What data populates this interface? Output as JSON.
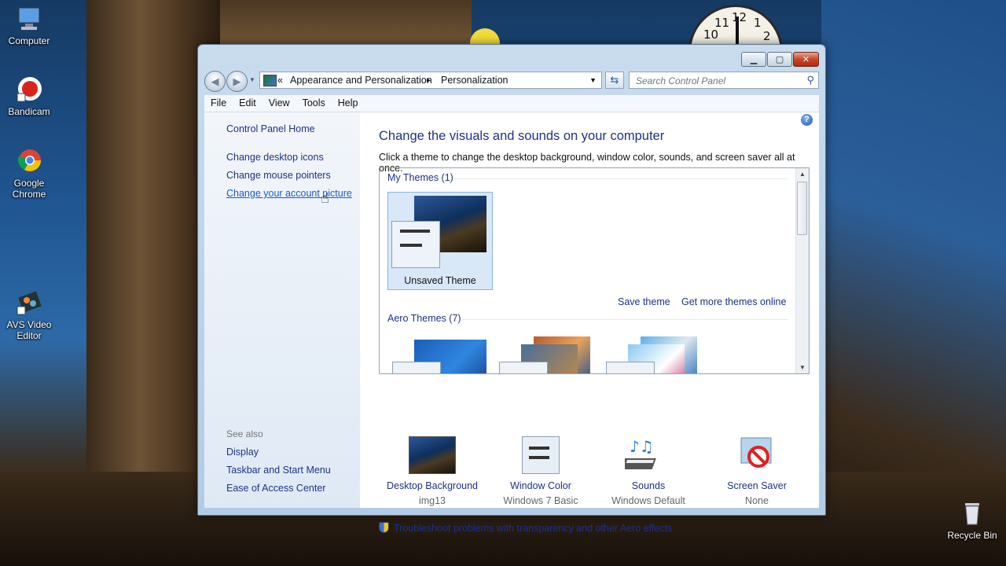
{
  "desktop": {
    "icons": [
      {
        "label": "Computer",
        "icon": "computer-icon"
      },
      {
        "label": "Bandicam",
        "icon": "bandicam-icon"
      },
      {
        "label": "Google Chrome",
        "icon": "chrome-icon"
      },
      {
        "label": "AVS Video Editor",
        "icon": "avs-video-editor-icon"
      },
      {
        "label": "Recycle Bin",
        "icon": "recycle-bin-icon"
      }
    ],
    "clock_numbers": [
      "10",
      "11",
      "12",
      "1",
      "2"
    ]
  },
  "window": {
    "breadcrumb": {
      "prefix": "«",
      "items": [
        "Appearance and Personalization",
        "Personalization"
      ],
      "separator": "▸"
    },
    "search_placeholder": "Search Control Panel",
    "menu": [
      "File",
      "Edit",
      "View",
      "Tools",
      "Help"
    ],
    "left_pane": {
      "home": "Control Panel Home",
      "links": [
        "Change desktop icons",
        "Change mouse pointers",
        "Change your account picture"
      ],
      "see_also_label": "See also",
      "see_also": [
        "Display",
        "Taskbar and Start Menu",
        "Ease of Access Center"
      ]
    },
    "content": {
      "title": "Change the visuals and sounds on your computer",
      "subtitle": "Click a theme to change the desktop background, window color, sounds, and screen saver all at once.",
      "my_themes_label": "My Themes (1)",
      "selected_theme": "Unsaved Theme",
      "save_theme": "Save theme",
      "get_more": "Get more themes online",
      "aero_themes_label": "Aero Themes (7)",
      "settings": [
        {
          "title": "Desktop Background",
          "value": "img13",
          "icon": "desktop-background-icon"
        },
        {
          "title": "Window Color",
          "value": "Windows 7 Basic",
          "icon": "window-color-icon"
        },
        {
          "title": "Sounds",
          "value": "Windows Default",
          "icon": "sounds-icon"
        },
        {
          "title": "Screen Saver",
          "value": "None",
          "icon": "screen-saver-icon"
        }
      ],
      "troubleshoot": "Troubleshoot problems with transparency and other Aero effects"
    }
  }
}
